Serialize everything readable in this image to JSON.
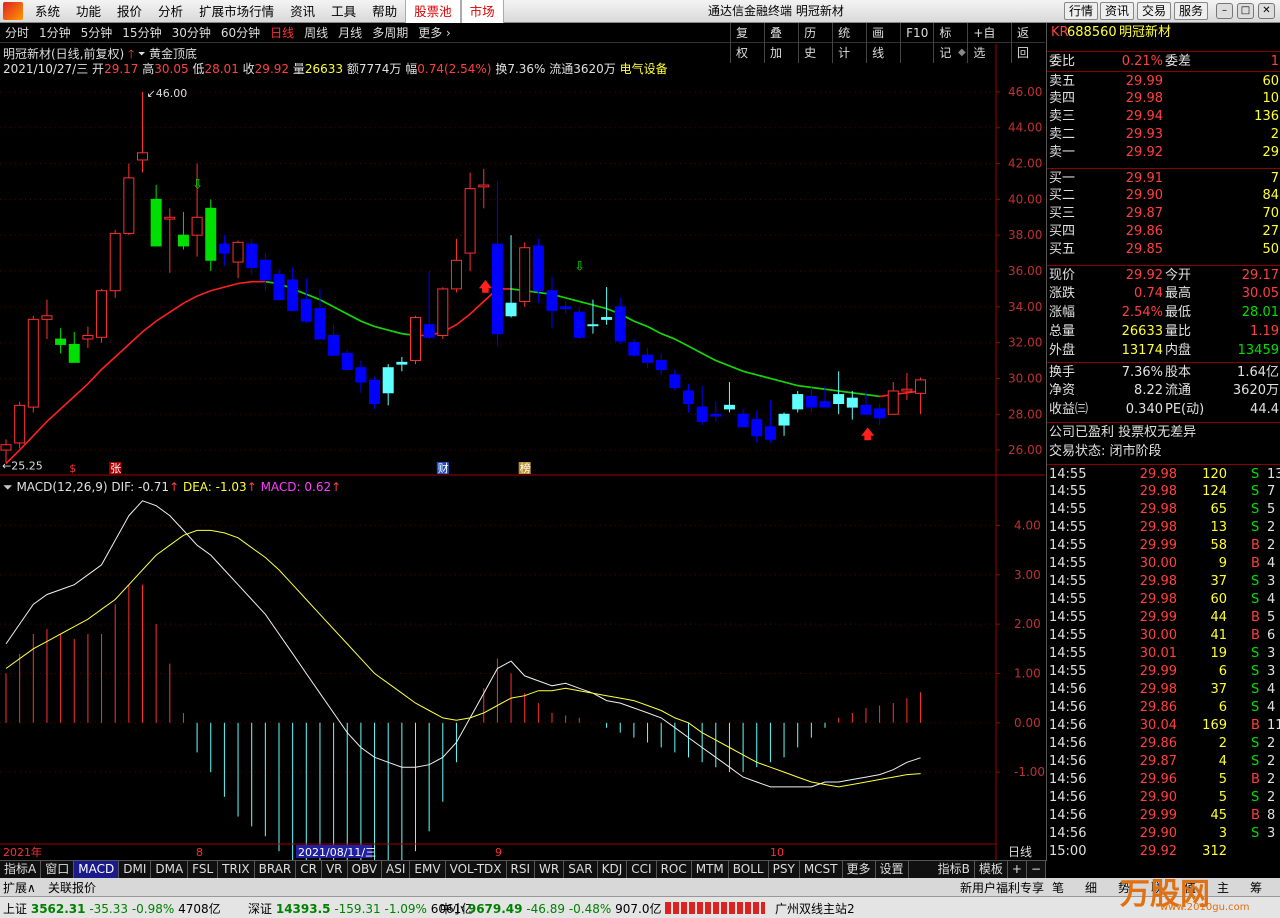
{
  "menu": {
    "items": [
      "系统",
      "功能",
      "报价",
      "分析",
      "扩展市场行情",
      "资讯",
      "工具",
      "帮助"
    ],
    "stockpool": "股票池",
    "market": "市场",
    "title": "通达信金融终端 明冠新材",
    "right_buttons": [
      "行情",
      "资讯",
      "交易",
      "服务"
    ]
  },
  "periods": [
    "分时",
    "1分钟",
    "5分钟",
    "15分钟",
    "30分钟",
    "60分钟",
    "日线",
    "周线",
    "月线",
    "多周期"
  ],
  "periods_active": "日线",
  "periods_more": "更多 ›",
  "toolbar_right": [
    "复权",
    "叠加",
    "历史",
    "统计",
    "画线",
    "F10",
    "标记",
    "+自选",
    "返回"
  ],
  "chart_info": {
    "name": "明冠新材(日线,前复权)",
    "indicator": "黄金顶底",
    "date": "2021/10/27/三",
    "open_label": "开",
    "open": "29.17",
    "high_label": "高",
    "high": "30.05",
    "low_label": "低",
    "low": "28.01",
    "close_label": "收",
    "close": "29.92",
    "vol_label": "量",
    "vol": "26633",
    "amt": "额7774万",
    "chg_label": "幅",
    "chg": "0.74(2.54%)",
    "turnover": "换7.36%",
    "float": "流通3620万",
    "sector": "电气设备"
  },
  "price_axis": [
    "46.00",
    "44.00",
    "42.00",
    "40.00",
    "38.00",
    "36.00",
    "34.00",
    "32.00",
    "30.00",
    "28.00",
    "26.00"
  ],
  "price_high_label": "46.00",
  "price_low_label": "25.25",
  "markers": [
    "$",
    "张",
    "财",
    "榜"
  ],
  "macd": {
    "title": "MACD(12,26,9)",
    "dif": "DIF: -0.71",
    "dea": "DEA: -1.03",
    "macd": "MACD: 0.62"
  },
  "macd_axis": [
    "4.00",
    "3.00",
    "2.00",
    "1.00",
    "0.00",
    "-1.00"
  ],
  "x_labels": [
    "2021年",
    "8",
    "2021/08/11/三",
    "9",
    "10"
  ],
  "x_period": "日线",
  "quote": {
    "code": "688560",
    "name": "明冠新材",
    "badge": "KR",
    "wb": {
      "label": "委比",
      "val": "0.21%",
      "label2": "委差",
      "val2": "1"
    },
    "asks": [
      {
        "l": "卖五",
        "p": "29.99",
        "v": "60"
      },
      {
        "l": "卖四",
        "p": "29.98",
        "v": "10"
      },
      {
        "l": "卖三",
        "p": "29.94",
        "v": "136"
      },
      {
        "l": "卖二",
        "p": "29.93",
        "v": "2"
      },
      {
        "l": "卖一",
        "p": "29.92",
        "v": "29"
      }
    ],
    "bids": [
      {
        "l": "买一",
        "p": "29.91",
        "v": "7"
      },
      {
        "l": "买二",
        "p": "29.90",
        "v": "84"
      },
      {
        "l": "买三",
        "p": "29.87",
        "v": "70"
      },
      {
        "l": "买四",
        "p": "29.86",
        "v": "27"
      },
      {
        "l": "买五",
        "p": "29.85",
        "v": "50"
      }
    ],
    "stats": [
      {
        "l1": "现价",
        "v1": "29.92",
        "l2": "今开",
        "v2": "29.17"
      },
      {
        "l1": "涨跌",
        "v1": "0.74",
        "l2": "最高",
        "v2": "30.05"
      },
      {
        "l1": "涨幅",
        "v1": "2.54%",
        "l2": "最低",
        "v2": "28.01"
      },
      {
        "l1": "总量",
        "v1": "26633",
        "l2": "量比",
        "v2": "1.19"
      },
      {
        "l1": "外盘",
        "v1": "13174",
        "l2": "内盘",
        "v2": "13459"
      }
    ],
    "stats2": [
      {
        "l1": "换手",
        "v1": "7.36%",
        "l2": "股本",
        "v2": "1.64亿"
      },
      {
        "l1": "净资",
        "v1": "8.22",
        "l2": "流通",
        "v2": "3620万"
      },
      {
        "l1": "收益㈢",
        "v1": "0.340",
        "l2": "PE(动)",
        "v2": "44.4"
      }
    ],
    "profit": "公司已盈利 投票权无差异",
    "state": "交易状态: 闭市阶段"
  },
  "ticks": [
    [
      "14:55",
      "29.98",
      "120",
      "S",
      "13"
    ],
    [
      "14:55",
      "29.98",
      "124",
      "S",
      "7"
    ],
    [
      "14:55",
      "29.98",
      "65",
      "S",
      "5"
    ],
    [
      "14:55",
      "29.98",
      "13",
      "S",
      "2"
    ],
    [
      "14:55",
      "29.99",
      "58",
      "B",
      "2"
    ],
    [
      "14:55",
      "30.00",
      "9",
      "B",
      "4"
    ],
    [
      "14:55",
      "29.98",
      "37",
      "S",
      "3"
    ],
    [
      "14:55",
      "29.98",
      "60",
      "S",
      "4"
    ],
    [
      "14:55",
      "29.99",
      "44",
      "B",
      "5"
    ],
    [
      "14:55",
      "30.00",
      "41",
      "B",
      "6"
    ],
    [
      "14:55",
      "30.01",
      "19",
      "S",
      "3"
    ],
    [
      "14:55",
      "29.99",
      "6",
      "S",
      "3"
    ],
    [
      "14:56",
      "29.98",
      "37",
      "S",
      "4"
    ],
    [
      "14:56",
      "29.86",
      "6",
      "S",
      "4"
    ],
    [
      "14:56",
      "30.04",
      "169",
      "B",
      "11"
    ],
    [
      "14:56",
      "29.86",
      "2",
      "S",
      "2"
    ],
    [
      "14:56",
      "29.87",
      "4",
      "S",
      "2"
    ],
    [
      "14:56",
      "29.96",
      "5",
      "B",
      "2"
    ],
    [
      "14:56",
      "29.90",
      "5",
      "S",
      "2"
    ],
    [
      "14:56",
      "29.99",
      "45",
      "B",
      "8"
    ],
    [
      "14:56",
      "29.90",
      "3",
      "S",
      "3"
    ],
    [
      "15:00",
      "29.92",
      "312",
      "",
      ""
    ]
  ],
  "tick_tabs": [
    "笔",
    "细",
    "势",
    "联",
    "值",
    "主",
    "筹"
  ],
  "ind_tabs": [
    "指标A",
    "窗口",
    "MACD",
    "DMI",
    "DMA",
    "FSL",
    "TRIX",
    "BRAR",
    "CR",
    "VR",
    "OBV",
    "ASI",
    "EMV",
    "VOL-TDX",
    "RSI",
    "WR",
    "SAR",
    "KDJ",
    "CCI",
    "ROC",
    "MTM",
    "BOLL",
    "PSY",
    "MCST",
    "更多",
    "设置"
  ],
  "ind_right": [
    "指标B",
    "模板"
  ],
  "ext": [
    "扩展∧",
    "关联报价"
  ],
  "ext_right": "新用户福利专享",
  "status": {
    "sh": "上证",
    "sh_v": "3562.31",
    "sh_c": "-35.33",
    "sh_p": "-0.98%",
    "sh_a": "4708亿",
    "sz": "深证",
    "sz_v": "14393.5",
    "sz_c": "-159.31",
    "sz_p": "-1.09%",
    "sz_a": "6061亿",
    "zx": "中小",
    "zx_v": "9679.49",
    "zx_c": "-46.89",
    "zx_p": "-0.48%",
    "zx_a": "907.0亿",
    "server": "广州双线主站2",
    "watermark": "万股网",
    "wm_url": "www.2010gu.com"
  },
  "chart_data": {
    "type": "candlestick",
    "candles": [
      [
        26.0,
        26.6,
        25.25,
        26.3
      ],
      [
        26.4,
        28.7,
        26.1,
        28.5
      ],
      [
        28.4,
        33.5,
        28.1,
        33.3
      ],
      [
        33.3,
        34.4,
        32.2,
        33.5
      ],
      [
        32.2,
        32.8,
        31.4,
        31.9
      ],
      [
        31.9,
        32.6,
        31.0,
        30.9
      ],
      [
        32.2,
        32.9,
        31.7,
        32.4
      ],
      [
        32.3,
        35.0,
        32.0,
        34.9
      ],
      [
        34.9,
        38.3,
        34.5,
        38.1
      ],
      [
        38.1,
        42.0,
        38.0,
        41.2
      ],
      [
        42.2,
        46.0,
        41.5,
        42.6
      ],
      [
        40.0,
        40.8,
        38.6,
        37.4
      ],
      [
        38.9,
        39.5,
        35.9,
        39.0
      ],
      [
        38.0,
        39.3,
        37.2,
        37.4
      ],
      [
        38.0,
        42.0,
        36.8,
        39.0
      ],
      [
        39.5,
        40.0,
        36.0,
        36.6
      ],
      [
        37.5,
        38.0,
        36.3,
        37.0
      ],
      [
        36.5,
        37.7,
        35.6,
        37.6
      ],
      [
        37.5,
        37.8,
        35.8,
        36.2
      ],
      [
        36.6,
        37.0,
        34.9,
        35.5
      ],
      [
        35.8,
        36.1,
        34.6,
        34.4
      ],
      [
        35.5,
        36.2,
        33.9,
        33.8
      ],
      [
        34.4,
        35.6,
        33.1,
        33.2
      ],
      [
        33.9,
        35.0,
        32.7,
        32.2
      ],
      [
        32.4,
        33.0,
        31.5,
        31.3
      ],
      [
        31.4,
        31.6,
        30.5,
        30.5
      ],
      [
        30.6,
        31.0,
        29.2,
        29.8
      ],
      [
        29.9,
        30.1,
        28.3,
        28.6
      ],
      [
        29.2,
        30.8,
        28.5,
        30.6
      ],
      [
        30.8,
        31.2,
        30.4,
        30.9
      ],
      [
        31.0,
        33.5,
        30.8,
        33.4
      ],
      [
        33.0,
        36.0,
        32.2,
        32.3
      ],
      [
        32.4,
        35.1,
        32.2,
        35.0
      ],
      [
        35.0,
        37.8,
        34.8,
        36.6
      ],
      [
        37.0,
        41.5,
        36.0,
        40.6
      ],
      [
        40.7,
        41.7,
        39.5,
        40.8
      ],
      [
        37.5,
        41.0,
        31.8,
        32.5
      ],
      [
        33.5,
        38.0,
        33.4,
        34.2
      ],
      [
        34.3,
        37.6,
        34.0,
        37.3
      ],
      [
        37.4,
        37.8,
        34.2,
        34.9
      ],
      [
        34.9,
        35.7,
        32.8,
        33.8
      ],
      [
        34.0,
        34.3,
        33.6,
        33.9
      ],
      [
        33.7,
        34.0,
        32.2,
        32.3
      ],
      [
        33.0,
        34.4,
        32.5,
        33.0
      ],
      [
        33.3,
        35.1,
        33.0,
        33.4
      ],
      [
        34.0,
        34.5,
        31.9,
        32.1
      ],
      [
        32.0,
        32.2,
        31.2,
        31.3
      ],
      [
        31.3,
        31.7,
        30.6,
        30.9
      ],
      [
        31.0,
        31.4,
        30.2,
        30.5
      ],
      [
        30.2,
        30.5,
        29.3,
        29.5
      ],
      [
        29.3,
        29.7,
        28.1,
        28.6
      ],
      [
        28.4,
        29.6,
        27.4,
        27.6
      ],
      [
        28.0,
        28.7,
        27.6,
        27.9
      ],
      [
        28.3,
        29.8,
        28.1,
        28.5
      ],
      [
        28.0,
        28.3,
        27.5,
        27.3
      ],
      [
        27.7,
        28.2,
        26.4,
        26.8
      ],
      [
        27.3,
        28.8,
        26.4,
        26.6
      ],
      [
        27.4,
        28.1,
        26.8,
        28.0
      ],
      [
        28.3,
        29.3,
        28.1,
        29.1
      ],
      [
        29.0,
        29.5,
        28.1,
        28.4
      ],
      [
        28.7,
        29.6,
        28.4,
        28.4
      ],
      [
        28.6,
        30.4,
        28.0,
        29.1
      ],
      [
        28.4,
        29.3,
        27.7,
        28.9
      ],
      [
        28.5,
        29.3,
        28.2,
        28.0
      ],
      [
        28.3,
        28.6,
        27.4,
        27.8
      ],
      [
        28.0,
        29.8,
        28.0,
        29.3
      ],
      [
        29.3,
        30.3,
        28.8,
        29.4
      ],
      [
        29.17,
        30.05,
        28.01,
        29.92
      ]
    ],
    "ma": [
      25.25,
      26.0,
      26.8,
      27.6,
      28.3,
      29.0,
      29.7,
      30.5,
      31.2,
      31.9,
      32.6,
      33.2,
      33.7,
      34.2,
      34.6,
      34.9,
      35.1,
      35.3,
      35.4,
      35.4,
      35.3,
      35.0,
      34.7,
      34.4,
      34.0,
      33.6,
      33.2,
      32.9,
      32.7,
      32.5,
      32.4,
      32.4,
      32.6,
      33.0,
      33.6,
      34.3,
      35.0,
      35.0,
      34.9,
      34.8,
      34.7,
      34.5,
      34.3,
      34.1,
      33.9,
      33.6,
      33.2,
      32.9,
      32.5,
      32.2,
      31.8,
      31.4,
      31.0,
      30.7,
      30.4,
      30.2,
      30.0,
      29.8,
      29.6,
      29.5,
      29.4,
      29.3,
      29.2,
      29.1,
      29.0,
      29.1,
      29.2,
      29.3
    ],
    "dif": [
      1.6,
      2.0,
      2.4,
      2.6,
      2.7,
      2.8,
      3.0,
      3.2,
      3.7,
      4.2,
      4.5,
      4.4,
      4.2,
      3.9,
      3.6,
      3.4,
      3.1,
      2.8,
      2.5,
      2.2,
      1.8,
      1.4,
      1.0,
      0.6,
      0.2,
      -0.2,
      -0.5,
      -0.7,
      -0.8,
      -0.9,
      -0.9,
      -0.85,
      -0.7,
      -0.4,
      0.1,
      0.6,
      1.1,
      1.25,
      0.95,
      0.85,
      0.75,
      0.8,
      0.7,
      0.6,
      0.45,
      0.4,
      0.3,
      0.2,
      0.1,
      -0.1,
      -0.3,
      -0.5,
      -0.7,
      -0.9,
      -1.1,
      -1.2,
      -1.3,
      -1.3,
      -1.3,
      -1.3,
      -1.2,
      -1.2,
      -1.15,
      -1.1,
      -1.05,
      -0.95,
      -0.8,
      -0.71
    ],
    "dea": [
      1.1,
      1.3,
      1.5,
      1.65,
      1.8,
      1.95,
      2.1,
      2.3,
      2.5,
      2.8,
      3.1,
      3.4,
      3.6,
      3.8,
      3.9,
      3.9,
      3.85,
      3.75,
      3.55,
      3.35,
      3.1,
      2.8,
      2.5,
      2.2,
      1.9,
      1.6,
      1.3,
      1.0,
      0.8,
      0.6,
      0.4,
      0.25,
      0.1,
      0.05,
      0.1,
      0.2,
      0.35,
      0.5,
      0.55,
      0.65,
      0.65,
      0.7,
      0.65,
      0.6,
      0.55,
      0.5,
      0.45,
      0.35,
      0.25,
      0.1,
      0.0,
      -0.2,
      -0.35,
      -0.5,
      -0.65,
      -0.8,
      -0.9,
      -1.0,
      -1.1,
      -1.2,
      -1.25,
      -1.3,
      -1.25,
      -1.2,
      -1.15,
      -1.1,
      -1.05,
      -1.03
    ],
    "macd_bars": [
      1.0,
      1.4,
      1.8,
      1.9,
      1.8,
      1.7,
      1.8,
      1.8,
      2.4,
      2.8,
      2.8,
      2.0,
      1.2,
      0.2,
      -0.6,
      -1.0,
      -1.5,
      -1.9,
      -2.1,
      -2.3,
      -2.6,
      -2.8,
      -2.9,
      -3.0,
      -3.2,
      -3.4,
      -3.4,
      -3.6,
      -3.3,
      -3.0,
      -2.6,
      -2.2,
      -1.6,
      -0.8,
      0.0,
      0.7,
      1.3,
      1.0,
      0.6,
      0.4,
      0.2,
      0.15,
      0.1,
      0.0,
      -0.1,
      -0.2,
      -0.3,
      -0.4,
      -0.5,
      -0.6,
      -0.7,
      -0.8,
      -0.9,
      -1.0,
      -1.0,
      -0.9,
      -0.8,
      -0.7,
      -0.5,
      -0.3,
      -0.1,
      0.1,
      0.2,
      0.3,
      0.35,
      0.4,
      0.5,
      0.62
    ],
    "price_ylim": [
      25.0,
      47.0
    ],
    "macd_ylim": [
      -2.7,
      4.8
    ]
  }
}
